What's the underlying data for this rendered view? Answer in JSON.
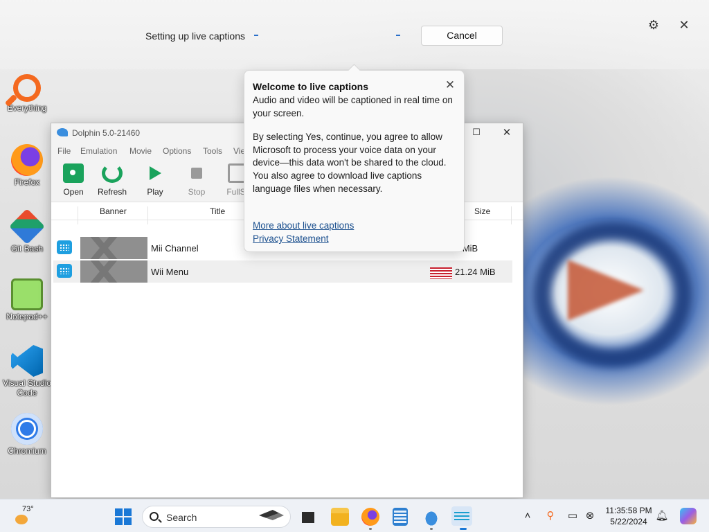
{
  "caption_bar": {
    "status_text": "Setting up live captions",
    "cancel_label": "Cancel",
    "settings_icon": "gear-icon",
    "close_icon": "close-icon"
  },
  "desktop": {
    "icons": [
      {
        "label": "Everything",
        "icon": "everything-search-icon"
      },
      {
        "label": "Firefox",
        "icon": "firefox-icon"
      },
      {
        "label": "Git Bash",
        "icon": "git-bash-icon"
      },
      {
        "label": "Notepad++",
        "icon": "notepad-plus-plus-icon"
      },
      {
        "label": "Visual Studio Code",
        "icon": "vscode-icon"
      },
      {
        "label": "Chromium",
        "icon": "chromium-icon"
      }
    ]
  },
  "dolphin": {
    "title": "Dolphin 5.0-21460",
    "menu": [
      "File",
      "Emulation",
      "Movie",
      "Options",
      "Tools",
      "Vie"
    ],
    "toolbar": {
      "open": "Open",
      "refresh": "Refresh",
      "play": "Play",
      "stop": "Stop",
      "fullscreen": "FullSc"
    },
    "columns": {
      "banner": "Banner",
      "title": "Title",
      "size": "Size"
    },
    "games": [
      {
        "title": "Mii Channel",
        "size": "1 MiB"
      },
      {
        "title": "Wii Menu",
        "size": "21.24 MiB"
      }
    ]
  },
  "popup": {
    "title": "Welcome to live captions",
    "para1": "Audio and video will be captioned in real time on your screen.",
    "para2": "By selecting Yes, continue, you agree to allow Microsoft to process your voice data on your device—this data won't be shared to the cloud. You also agree to download live captions language files when necessary.",
    "link_more": "More about live captions",
    "link_privacy": "Privacy Statement"
  },
  "taskbar": {
    "temperature": "73°",
    "search_placeholder": "Search",
    "time": "11:35:58 PM",
    "date": "5/22/2024"
  },
  "colors": {
    "accent": "#1a78d6",
    "dolphin_green": "#1aa35c",
    "link": "#1a4f8e"
  }
}
